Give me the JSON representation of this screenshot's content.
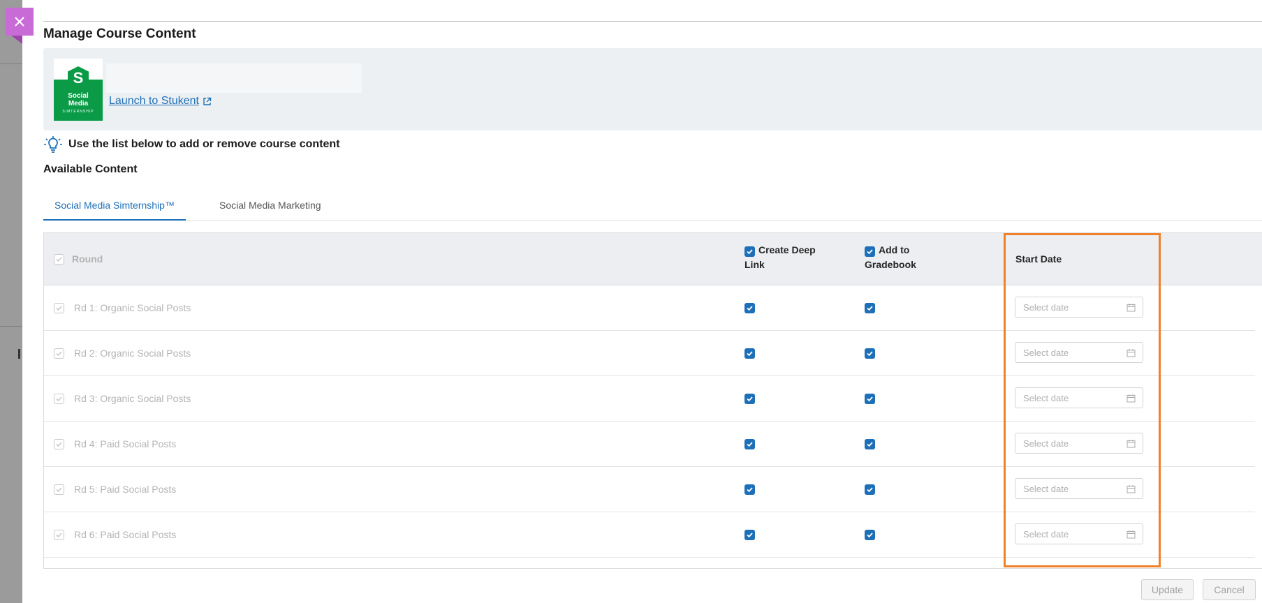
{
  "page": {
    "title": "Manage Course Content",
    "launch_link": "Launch to Stukent",
    "hint": "Use the list below to add or remove course content",
    "section_title": "Available Content"
  },
  "logo": {
    "letter": "S",
    "line1": "Social",
    "line2": "Media",
    "line3": "SIMTERNSHIP"
  },
  "tabs": [
    {
      "label": "Social Media Simternship™",
      "active": true
    },
    {
      "label": "Social Media Marketing",
      "active": false
    }
  ],
  "table": {
    "headers": {
      "round": "Round",
      "deep_link_line1": "Create Deep",
      "deep_link_line2": "Link",
      "gradebook_line1": "Add to",
      "gradebook_line2": "Gradebook",
      "start_date": "Start Date"
    },
    "date_placeholder": "Select date",
    "rows": [
      {
        "label": "Rd 1: Organic Social Posts",
        "round_checked": true,
        "deep_link": true,
        "gradebook": true
      },
      {
        "label": "Rd 2: Organic Social Posts",
        "round_checked": true,
        "deep_link": true,
        "gradebook": true
      },
      {
        "label": "Rd 3: Organic Social Posts",
        "round_checked": true,
        "deep_link": true,
        "gradebook": true
      },
      {
        "label": "Rd 4: Paid Social Posts",
        "round_checked": true,
        "deep_link": true,
        "gradebook": true
      },
      {
        "label": "Rd 5: Paid Social Posts",
        "round_checked": true,
        "deep_link": true,
        "gradebook": true
      },
      {
        "label": "Rd 6: Paid Social Posts",
        "round_checked": true,
        "deep_link": true,
        "gradebook": true
      }
    ]
  },
  "buttons": {
    "update": "Update",
    "cancel": "Cancel"
  },
  "colors": {
    "accent": "#1d6fb8",
    "close_button": "#c86bd6",
    "highlight": "#f0812b",
    "logo_green": "#0b9b47"
  }
}
